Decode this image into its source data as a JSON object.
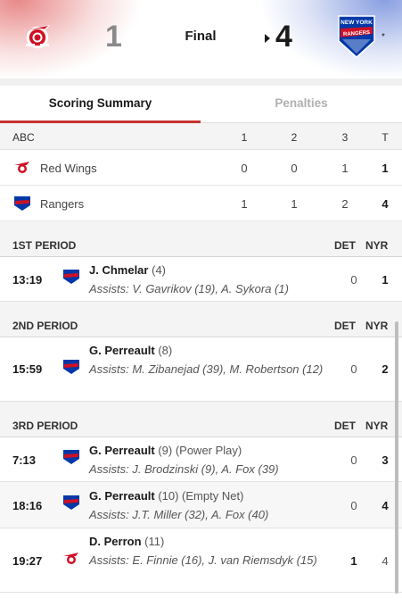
{
  "header": {
    "home_score": "1",
    "status": "Final",
    "away_score": "4",
    "star": "*",
    "home_logo_icon": "red-wings-logo",
    "away_logo_icon": "rangers-logo",
    "away_logo_text": [
      "NEW YORK",
      "RANGERS"
    ]
  },
  "tabs": [
    {
      "label": "Scoring Summary",
      "active": true
    },
    {
      "label": "Penalties",
      "active": false
    }
  ],
  "linescore": {
    "header": [
      "ABC",
      "1",
      "2",
      "3",
      "T"
    ],
    "rows": [
      {
        "team": "Red Wings",
        "logo": "red-wings-logo",
        "p1": "0",
        "p2": "0",
        "p3": "1",
        "t": "1"
      },
      {
        "team": "Rangers",
        "logo": "rangers-logo",
        "p1": "1",
        "p2": "1",
        "p3": "2",
        "t": "4"
      }
    ]
  },
  "periods": [
    {
      "label": "1ST PERIOD",
      "det": "DET",
      "nyr": "NYR",
      "goals": [
        {
          "time": "13:19",
          "team": "rangers",
          "scorer": "J. Chmelar",
          "extra": "(4)",
          "assists": "Assists: V. Gavrikov (19), A. Sykora (1)",
          "det": "0",
          "nyr": "1"
        }
      ]
    },
    {
      "label": "2ND PERIOD",
      "det": "DET",
      "nyr": "NYR",
      "goals": [
        {
          "time": "15:59",
          "team": "rangers",
          "scorer": "G. Perreault",
          "extra": "(8)",
          "assists": "Assists: M. Zibanejad (39), M. Robertson (12)",
          "det": "0",
          "nyr": "2"
        }
      ]
    },
    {
      "label": "3RD PERIOD",
      "det": "DET",
      "nyr": "NYR",
      "goals": [
        {
          "time": "7:13",
          "team": "rangers",
          "scorer": "G. Perreault",
          "extra": "(9) (Power Play)",
          "assists": "Assists: J. Brodzinski (9), A. Fox (39)",
          "det": "0",
          "nyr": "3"
        },
        {
          "time": "18:16",
          "team": "rangers",
          "scorer": "G. Perreault",
          "extra": "(10) (Empty Net)",
          "assists": "Assists: J.T. Miller (32), A. Fox (40)",
          "det": "0",
          "nyr": "4"
        },
        {
          "time": "19:27",
          "team": "red-wings",
          "scorer": "D. Perron",
          "extra": "(11)",
          "assists": "Assists: E. Finnie (16), J. van Riemsdyk (15)",
          "det": "1",
          "nyr": "4"
        }
      ]
    }
  ],
  "colors": {
    "accent": "#c8312e",
    "red_wings": "#ce1126",
    "rangers_blue": "#0038a8"
  }
}
